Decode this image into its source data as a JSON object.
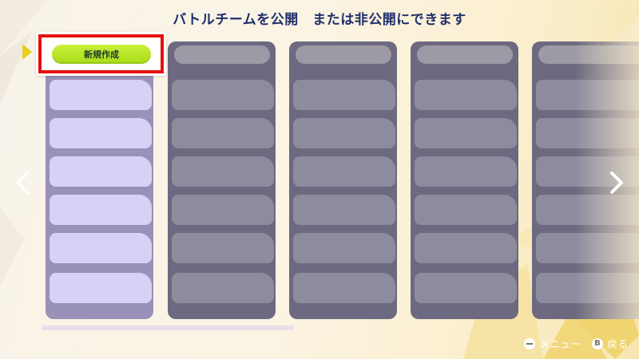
{
  "header": {
    "title": "バトルチームを公開　または非公開にできます"
  },
  "new_team_button": {
    "label": "新規作成"
  },
  "footer": {
    "menu_label": "メニュー",
    "back_button_glyph": "B",
    "back_label": "戻る"
  },
  "colors": {
    "highlight_outline": "#e60f0f",
    "new_button_green": "#b9e62a",
    "cursor_yellow": "#e6cf1f",
    "active_column": "#9a91b8",
    "inactive_column": "#6d6980"
  },
  "icons": {
    "left_nav": "chevron-left-icon",
    "right_nav": "chevron-right-icon",
    "menu_button": "minus-button-icon",
    "back_button": "b-button-icon",
    "cursor": "selection-cursor-icon"
  }
}
